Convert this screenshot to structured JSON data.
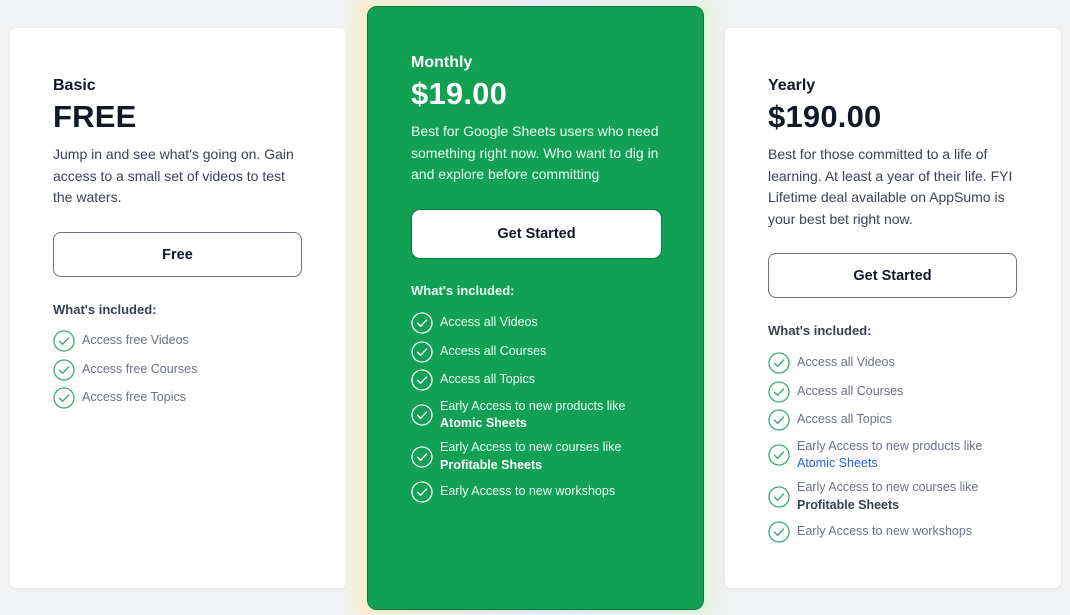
{
  "plans": {
    "basic": {
      "name": "Basic",
      "price": "FREE",
      "description": "Jump in and see what's going on. Gain access to a small set of videos to test the waters.",
      "button": "Free",
      "included_title": "What's included:",
      "features": [
        {
          "text": "Access free Videos"
        },
        {
          "text": "Access free Courses"
        },
        {
          "text": "Access free Topics"
        }
      ]
    },
    "monthly": {
      "name": "Monthly",
      "price": "$19.00",
      "description": "Best for Google Sheets users who need something right now. Who want to dig in and explore before committing",
      "button": "Get Started",
      "included_title": "What's included:",
      "features": [
        {
          "text": "Access all Videos"
        },
        {
          "text": "Access all Courses"
        },
        {
          "text": "Access all Topics"
        },
        {
          "prefix": "Early Access to new products like ",
          "strong": "Atomic Sheets"
        },
        {
          "prefix": "Early Access to new courses like ",
          "strong": "Profitable Sheets"
        },
        {
          "text": "Early Access to new workshops"
        }
      ]
    },
    "yearly": {
      "name": "Yearly",
      "price": "$190.00",
      "description": "Best for those committed to a life of learning. At least a year of their life. FYI Lifetime deal available on AppSumo is your best bet right now.",
      "button": "Get Started",
      "included_title": "What's included:",
      "features": [
        {
          "text": "Access all Videos"
        },
        {
          "text": "Access all Courses"
        },
        {
          "text": "Access all Topics"
        },
        {
          "prefix": "Early Access to new products like ",
          "link": "Atomic Sheets"
        },
        {
          "prefix": "Early Access to new courses like ",
          "strong": "Profitable Sheets"
        },
        {
          "text": "Early Access to new workshops"
        }
      ]
    }
  },
  "colors": {
    "accent_green": "#11a054",
    "check_green": "#3aa872",
    "link_blue": "#2563eb"
  },
  "icons": {
    "feature": "check-circle-icon"
  }
}
